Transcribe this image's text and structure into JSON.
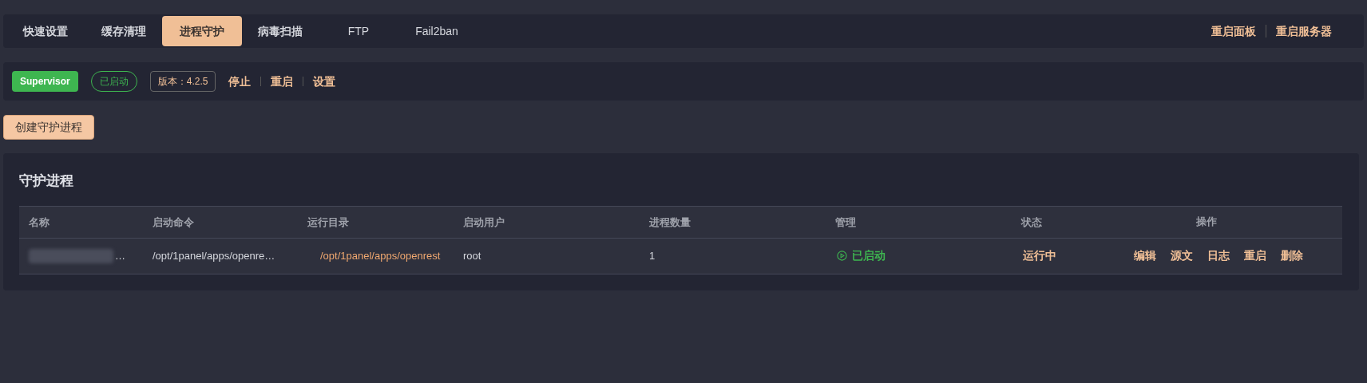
{
  "tabs": [
    {
      "label": "快速设置",
      "selected": false
    },
    {
      "label": "缓存清理",
      "selected": false
    },
    {
      "label": "进程守护",
      "selected": true
    },
    {
      "label": "病毒扫描",
      "selected": false
    },
    {
      "label": "FTP",
      "selected": false
    },
    {
      "label": "Fail2ban",
      "selected": false
    }
  ],
  "top_actions": [
    "重启面板",
    "重启服务器"
  ],
  "service": {
    "name": "Supervisor",
    "status": "已启动",
    "running": true,
    "version": "版本：4.2.5",
    "actions": [
      "停止",
      "重启",
      "设置"
    ]
  },
  "create_button": "创建守护进程",
  "table": {
    "title": "守护进程",
    "columns": [
      "名称",
      "启动命令",
      "运行目录",
      "启动用户",
      "进程数量",
      "管理",
      "状态",
      "操作"
    ],
    "rows": [
      {
        "name": "…",
        "name_redacted": true,
        "command": "/opt/1panel/apps/openre…",
        "directory": "/opt/1panel/apps/openrest",
        "user": "root",
        "count": "1",
        "manage": "已启动",
        "running": true,
        "status": "运行中",
        "actions": [
          "编辑",
          "源文",
          "日志",
          "重启",
          "删除"
        ]
      }
    ]
  }
}
